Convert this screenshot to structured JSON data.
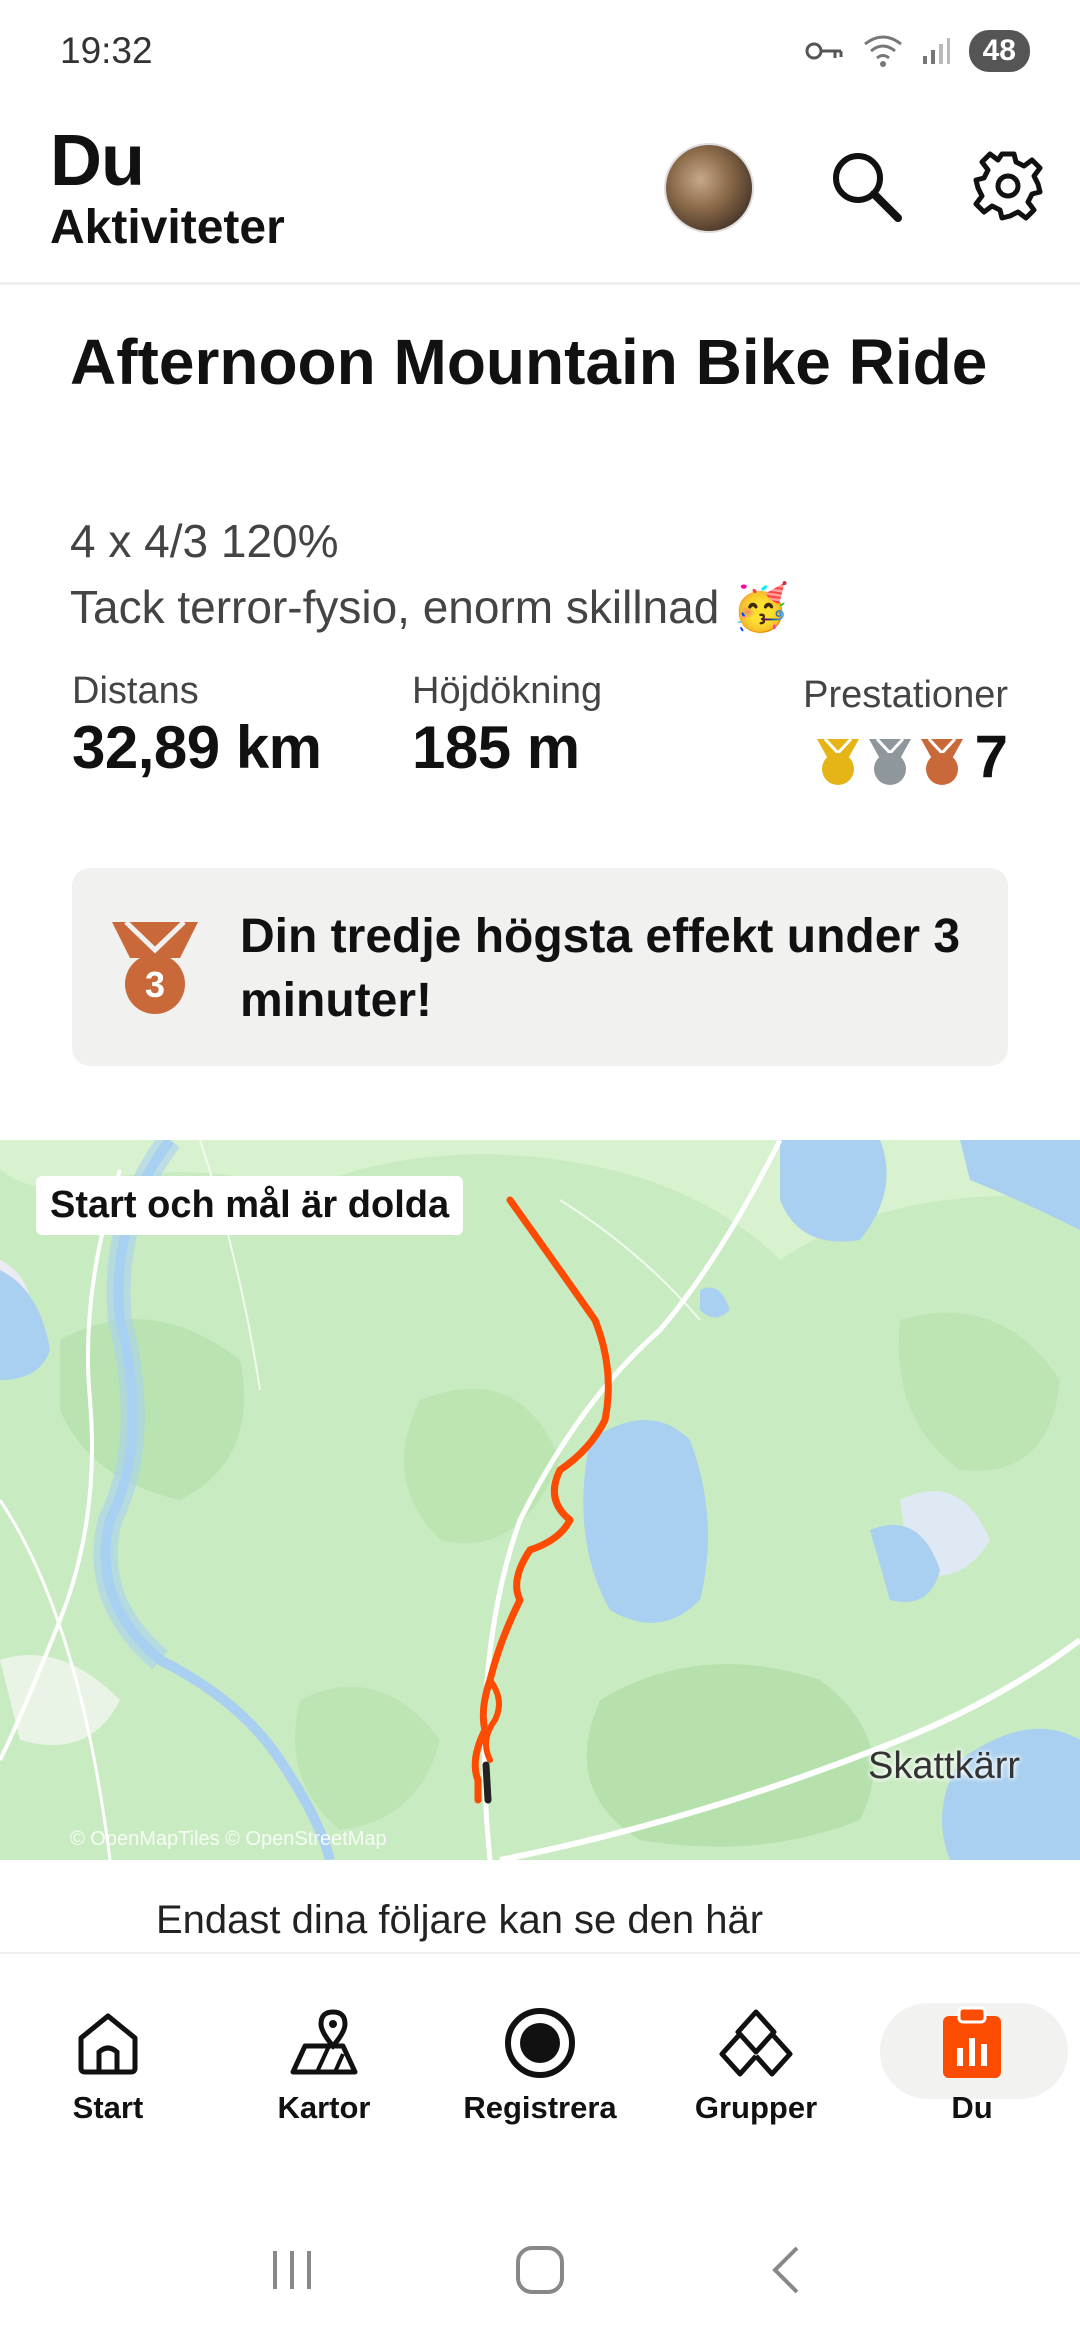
{
  "status_bar": {
    "time": "19:32",
    "battery": "48"
  },
  "header": {
    "title": "Du",
    "subtitle": "Aktiviteter"
  },
  "activity": {
    "title": "Afternoon Mountain Bike Ride",
    "description_line1": "4 x 4/3 120%",
    "description_line2": "Tack terror-fysio, enorm skillnad 🥳",
    "stats": [
      {
        "label": "Distans",
        "value": "32,89 km"
      },
      {
        "label": "Höjdökning",
        "value": "185 m"
      }
    ],
    "achievements": {
      "label": "Prestationer",
      "count": "7"
    }
  },
  "achievement_card": {
    "badge_number": "3",
    "text": "Din tredje högsta effekt under 3 minuter!"
  },
  "map": {
    "badge": "Start och mål är dolda",
    "place_label": "Skattkärr",
    "attribution": "© OpenMapTiles © OpenStreetMap",
    "route_color": "#fc4c02"
  },
  "privacy_text": "Endast dina följare kan se den här",
  "bottom_nav": [
    {
      "label": "Start",
      "icon": "home-icon"
    },
    {
      "label": "Kartor",
      "icon": "map-icon"
    },
    {
      "label": "Registrera",
      "icon": "record-icon"
    },
    {
      "label": "Grupper",
      "icon": "groups-icon"
    },
    {
      "label": "Du",
      "icon": "profile-clipboard-icon",
      "active": true
    }
  ],
  "colors": {
    "accent": "#fc4c02",
    "gold": "#e5b416",
    "silver": "#8e979c",
    "bronze": "#c9693a"
  }
}
